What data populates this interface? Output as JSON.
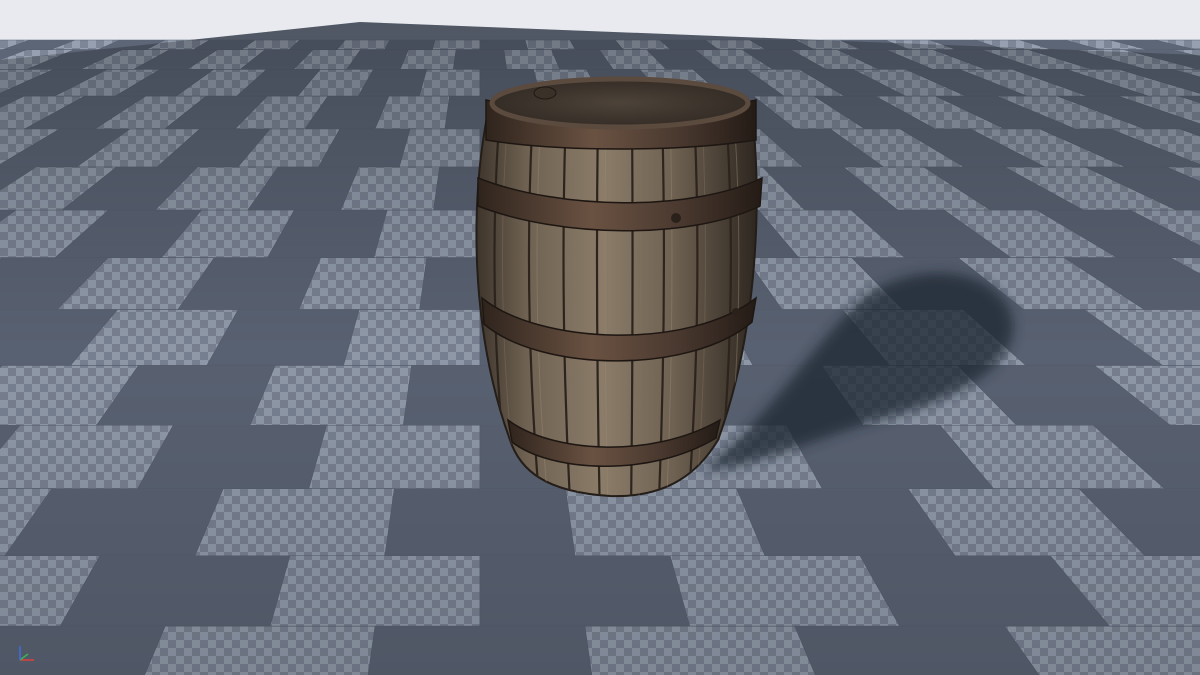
{
  "viewport": {
    "sky_color": "#e8eaef",
    "floor_color_dark": "#5d6677",
    "floor_color_light": "#8a93a3",
    "floor_pattern": "checker-grid",
    "object": "wooden-barrel",
    "wood_color": "#6f6252",
    "wood_dark_color": "#3d342b",
    "iron_band_color": "#4b3a30",
    "shadow_color": "#2b3140"
  },
  "gizmo": {
    "axes": [
      {
        "name": "x",
        "color": "#e0403a"
      },
      {
        "name": "y",
        "color": "#3fb34f"
      },
      {
        "name": "z",
        "color": "#3c6fe0"
      }
    ]
  }
}
